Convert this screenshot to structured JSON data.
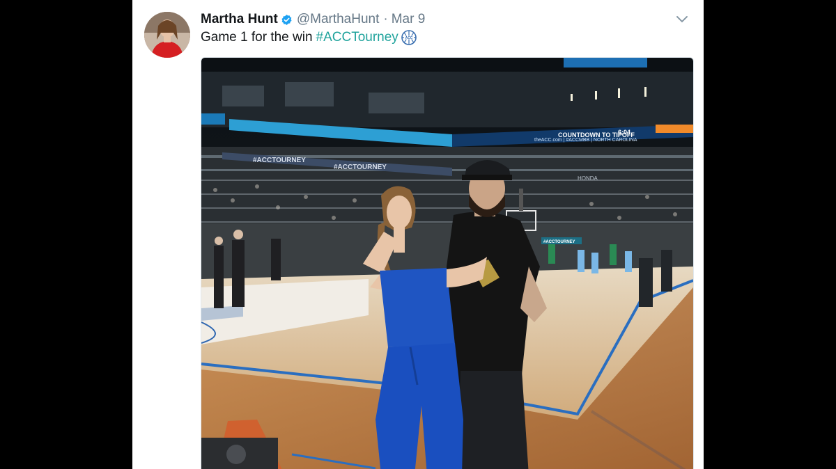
{
  "tweet": {
    "author_name": "Martha Hunt",
    "handle": "@MarthaHunt",
    "separator": "·",
    "date": "Mar 9",
    "text_prefix": "Game 1 for the win",
    "hashtag": "#ACCTourney"
  },
  "photo": {
    "scoreboard_text": "COUNTDOWN TO TIPOFF",
    "scoreboard_time": "6:04",
    "banner_text": "#ACCTOURNEY",
    "banner_text_2": "#ACCTOURNEY",
    "sponsor_text": "HONDA",
    "ribbon_text": "theACC.com | #ACCMBB | NORTH CAROLINA",
    "side_banner_text": "#ACCTOURNEY"
  },
  "colors": {
    "name": "#14171a",
    "secondary": "#657786",
    "hashtag": "#1fa39c",
    "verified": "#1da1f2",
    "background": "#000000",
    "card": "#ffffff"
  },
  "icons": {
    "verified": "verified-badge-icon",
    "caret": "chevron-down-icon",
    "acc": "acc-basketball-icon"
  }
}
